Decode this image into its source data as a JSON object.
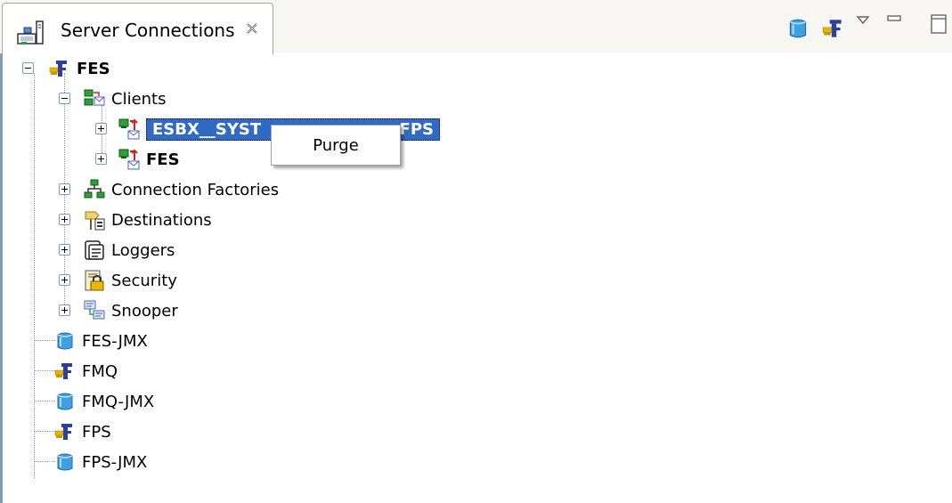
{
  "view": {
    "tab_title": "Server Connections",
    "tab_icon": "server-connections-icon",
    "close_icon": "close-icon",
    "toolbar": [
      "jmx-server-icon",
      "ems-server-icon",
      "view-menu-icon",
      "minimize-icon",
      "maximize-icon"
    ]
  },
  "tree": {
    "root": {
      "label": "FES",
      "icon": "ems-server-icon",
      "expanded": true
    },
    "clients": {
      "label": "Clients",
      "icon": "clients-icon",
      "items": [
        {
          "label": "ESBX__SYSTEM__FPS",
          "label_visible_left": "ESBX__SYST",
          "label_visible_right": "FPS",
          "selected": true
        },
        {
          "label": "FES"
        }
      ]
    },
    "folders": [
      {
        "label": "Connection Factories",
        "icon": "connection-factories-icon"
      },
      {
        "label": "Destinations",
        "icon": "destinations-icon"
      },
      {
        "label": "Loggers",
        "icon": "loggers-icon"
      },
      {
        "label": "Security",
        "icon": "security-icon"
      },
      {
        "label": "Snooper",
        "icon": "snooper-icon"
      }
    ],
    "servers": [
      {
        "label": "FES-JMX",
        "icon": "jmx-server-icon"
      },
      {
        "label": "FMQ",
        "icon": "ems-server-icon"
      },
      {
        "label": "FMQ-JMX",
        "icon": "jmx-server-icon"
      },
      {
        "label": "FPS",
        "icon": "ems-server-icon"
      },
      {
        "label": "FPS-JMX",
        "icon": "jmx-server-icon"
      }
    ]
  },
  "context_menu": {
    "items": [
      {
        "label": "Purge"
      }
    ]
  },
  "colors": {
    "selection": "#316ac5",
    "tab_bg": "#f7f6f2",
    "jmx_blue": "#3f9fe0",
    "ems_gold": "#d8a400",
    "ems_blue": "#2a3fa0"
  }
}
